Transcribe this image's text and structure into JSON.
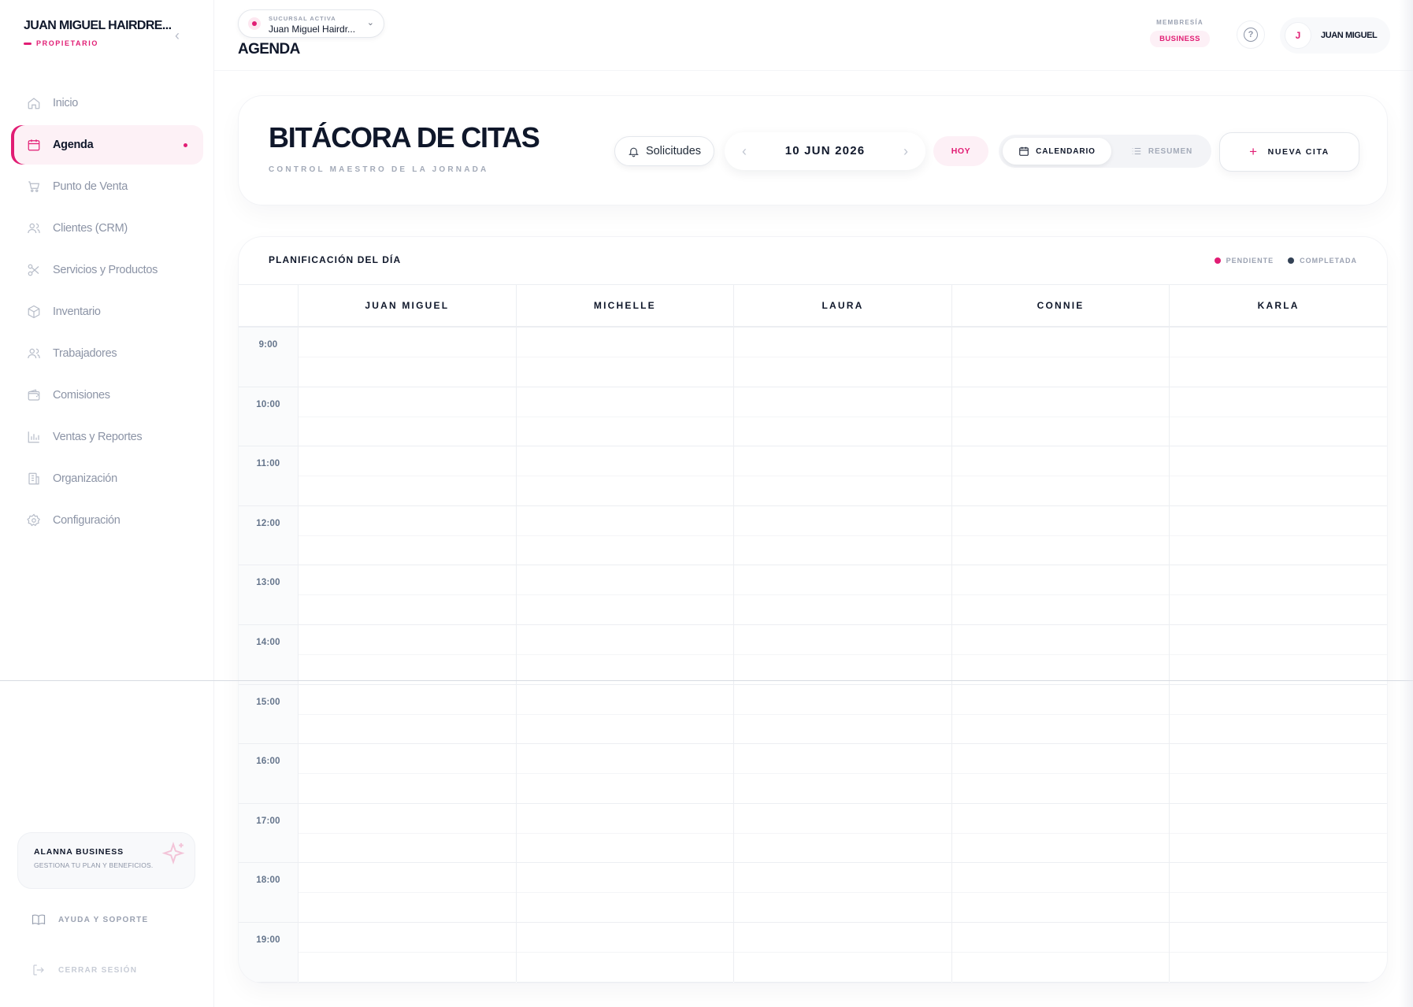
{
  "sidebar": {
    "brand_title": "JUAN MIGUEL HAIRDRE...",
    "brand_role": "PROPIETARIO",
    "collapse_icon": "chevron-left-icon",
    "items": [
      {
        "label": "Inicio",
        "icon": "home-icon",
        "active": false
      },
      {
        "label": "Agenda",
        "icon": "calendar-icon",
        "active": true
      },
      {
        "label": "Punto de Venta",
        "icon": "cart-icon",
        "active": false
      },
      {
        "label": "Clientes (CRM)",
        "icon": "users-icon",
        "active": false
      },
      {
        "label": "Servicios y Productos",
        "icon": "scissors-icon",
        "active": false
      },
      {
        "label": "Inventario",
        "icon": "box-icon",
        "active": false
      },
      {
        "label": "Trabajadores",
        "icon": "team-icon",
        "active": false
      },
      {
        "label": "Comisiones",
        "icon": "wallet-icon",
        "active": false
      },
      {
        "label": "Ventas y Reportes",
        "icon": "bar-chart-icon",
        "active": false
      },
      {
        "label": "Organización",
        "icon": "building-icon",
        "active": false
      },
      {
        "label": "Configuración",
        "icon": "gear-icon",
        "active": false
      }
    ],
    "promo_title": "ALANNA BUSINESS",
    "promo_subtitle": "GESTIONA TU PLAN Y BENEFICIOS.",
    "help_label": "AYUDA Y SOPORTE",
    "logout_label": "CERRAR SESIÓN"
  },
  "topbar": {
    "branch_label": "SUCURSAL ACTIVA",
    "branch_value": "Juan Miguel Hairdr...",
    "page_title": "AGENDA",
    "membership_label": "MEMBRESÍA",
    "membership_value": "BUSINESS",
    "user_initial": "J",
    "user_name": "JUAN MIGUEL"
  },
  "header": {
    "title": "BITÁCORA DE CITAS",
    "subtitle": "CONTROL MAESTRO DE LA JORNADA",
    "requests_label": "Solicitudes",
    "date": "10 JUN 2026",
    "today_label": "HOY",
    "view_calendar": "CALENDARIO",
    "view_summary": "RESUMEN",
    "new_appointment": "NUEVA CITA"
  },
  "schedule": {
    "title": "PLANIFICACIÓN DEL DÍA",
    "legend": [
      {
        "label": "PENDIENTE",
        "color": "#e11d74"
      },
      {
        "label": "COMPLETADA",
        "color": "#334155"
      }
    ],
    "staff": [
      "JUAN MIGUEL",
      "MICHELLE",
      "LAURA",
      "CONNIE",
      "KARLA"
    ],
    "hours": [
      "9:00",
      "10:00",
      "11:00",
      "12:00",
      "13:00",
      "14:00",
      "15:00",
      "16:00",
      "17:00",
      "18:00",
      "19:00"
    ]
  },
  "colors": {
    "accent": "#e11d74",
    "text": "#0f172a",
    "muted": "#8c94a6"
  }
}
